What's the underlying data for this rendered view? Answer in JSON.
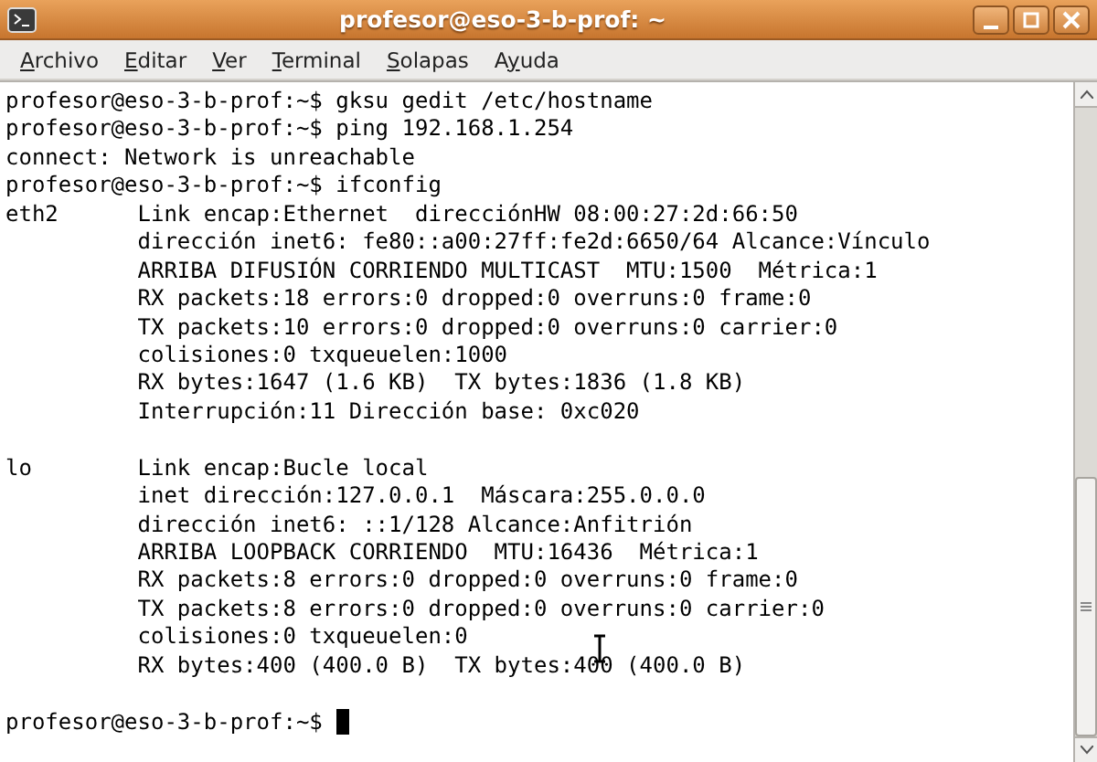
{
  "window": {
    "title": "profesor@eso-3-b-prof: ~"
  },
  "menu": [
    {
      "key": "A",
      "rest": "rchivo"
    },
    {
      "key": "E",
      "rest": "ditar"
    },
    {
      "key": "V",
      "rest": "er"
    },
    {
      "key": "T",
      "rest": "erminal"
    },
    {
      "key": "S",
      "rest": "olapas"
    },
    {
      "before": "A",
      "key": "y",
      "rest": "uda"
    }
  ],
  "terminal": {
    "lines": [
      {
        "kind": "text",
        "text": "profesor@eso-3-b-prof:~$ gksu gedit /etc/hostname"
      },
      {
        "kind": "text",
        "text": "profesor@eso-3-b-prof:~$ ping 192.168.1.254"
      },
      {
        "kind": "text",
        "text": "connect: Network is unreachable"
      },
      {
        "kind": "text",
        "text": "profesor@eso-3-b-prof:~$ ifconfig"
      },
      {
        "kind": "text",
        "text": "eth2      Link encap:Ethernet  direcciónHW 08:00:27:2d:66:50  "
      },
      {
        "kind": "text",
        "text": "          dirección inet6: fe80::a00:27ff:fe2d:6650/64 Alcance:Vínculo"
      },
      {
        "kind": "text",
        "text": "          ARRIBA DIFUSIÓN CORRIENDO MULTICAST  MTU:1500  Métrica:1"
      },
      {
        "kind": "text",
        "text": "          RX packets:18 errors:0 dropped:0 overruns:0 frame:0"
      },
      {
        "kind": "text",
        "text": "          TX packets:10 errors:0 dropped:0 overruns:0 carrier:0"
      },
      {
        "kind": "text",
        "text": "          colisiones:0 txqueuelen:1000 "
      },
      {
        "kind": "text",
        "text": "          RX bytes:1647 (1.6 KB)  TX bytes:1836 (1.8 KB)"
      },
      {
        "kind": "text",
        "text": "          Interrupción:11 Dirección base: 0xc020 "
      },
      {
        "kind": "blank"
      },
      {
        "kind": "text",
        "text": "lo        Link encap:Bucle local  "
      },
      {
        "kind": "text",
        "text": "          inet dirección:127.0.0.1  Máscara:255.0.0.0"
      },
      {
        "kind": "text",
        "text": "          dirección inet6: ::1/128 Alcance:Anfitrión"
      },
      {
        "kind": "text",
        "text": "          ARRIBA LOOPBACK CORRIENDO  MTU:16436  Métrica:1"
      },
      {
        "kind": "text",
        "text": "          RX packets:8 errors:0 dropped:0 overruns:0 frame:0"
      },
      {
        "kind": "text",
        "text": "          TX packets:8 errors:0 dropped:0 overruns:0 carrier:0"
      },
      {
        "kind": "text",
        "text": "          colisiones:0 txqueuelen:0 "
      },
      {
        "kind": "text",
        "text": "          RX bytes:400 (400.0 B)  TX bytes:400 (400.0 B)"
      },
      {
        "kind": "blank"
      },
      {
        "kind": "prompt",
        "text": "profesor@eso-3-b-prof:~$ ",
        "cursor": true
      }
    ]
  }
}
